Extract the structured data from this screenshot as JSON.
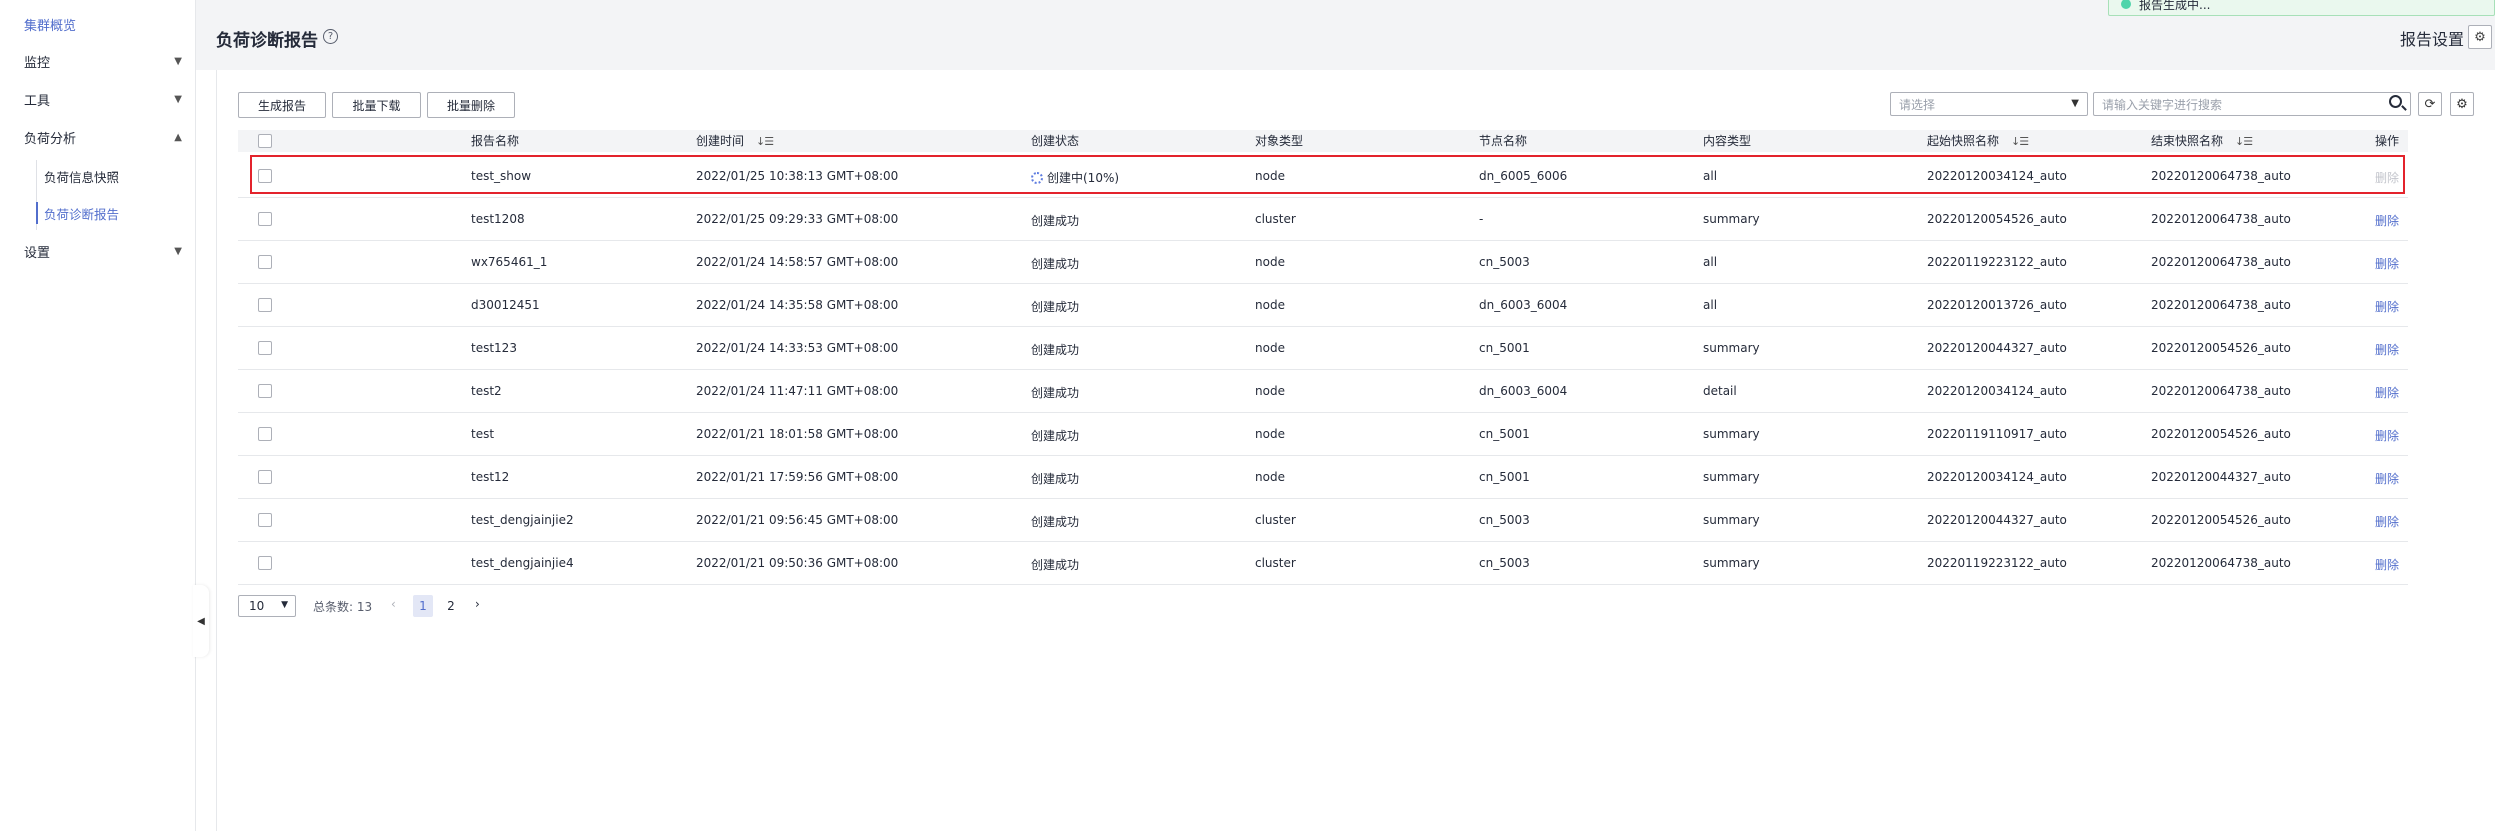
{
  "sidebar": {
    "items": [
      {
        "label": "集群概览",
        "active": true
      },
      {
        "label": "监控",
        "chevron": "chevron-down-icon"
      },
      {
        "label": "工具",
        "chevron": "chevron-down-icon"
      },
      {
        "label": "负荷分析",
        "chevron": "chevron-up-icon"
      },
      {
        "label": "设置",
        "chevron": "chevron-down-icon"
      }
    ],
    "sub_items": [
      {
        "label": "负荷信息快照"
      },
      {
        "label": "负荷诊断报告",
        "active": true
      }
    ],
    "collapse_glyph": "◀"
  },
  "header": {
    "title": "负荷诊断报告",
    "help_glyph": "?",
    "report_settings_label": "报告设置",
    "gear_glyph": "⚙",
    "toast_text": "报告生成中..."
  },
  "toolbar": {
    "generate_label": "生成报告",
    "batch_download_label": "批量下载",
    "batch_delete_label": "批量删除",
    "filter_placeholder": "请选择",
    "search_placeholder": "请输入关键字进行搜索",
    "refresh_glyph": "⟳",
    "settings_glyph": "⚙"
  },
  "table": {
    "columns": [
      "报告名称",
      "创建时间",
      "创建状态",
      "对象类型",
      "节点名称",
      "内容类型",
      "起始快照名称",
      "结束快照名称",
      "操作"
    ],
    "sort_glyph": "↓☰",
    "rows": [
      {
        "name": "test_show",
        "time": "2022/01/25 10:38:13 GMT+08:00",
        "status": "创建中(10%)",
        "creating": true,
        "obj": "node",
        "node": "dn_6005_6006",
        "content": "all",
        "start": "20220120034124_auto",
        "end": "20220120064738_auto",
        "op": "删除"
      },
      {
        "name": "test1208",
        "time": "2022/01/25 09:29:33 GMT+08:00",
        "status": "创建成功",
        "obj": "cluster",
        "node": "-",
        "content": "summary",
        "start": "20220120054526_auto",
        "end": "20220120064738_auto",
        "op": "删除"
      },
      {
        "name": "wx765461_1",
        "time": "2022/01/24 14:58:57 GMT+08:00",
        "status": "创建成功",
        "obj": "node",
        "node": "cn_5003",
        "content": "all",
        "start": "20220119223122_auto",
        "end": "20220120064738_auto",
        "op": "删除"
      },
      {
        "name": "d30012451",
        "time": "2022/01/24 14:35:58 GMT+08:00",
        "status": "创建成功",
        "obj": "node",
        "node": "dn_6003_6004",
        "content": "all",
        "start": "20220120013726_auto",
        "end": "20220120064738_auto",
        "op": "删除"
      },
      {
        "name": "test123",
        "time": "2022/01/24 14:33:53 GMT+08:00",
        "status": "创建成功",
        "obj": "node",
        "node": "cn_5001",
        "content": "summary",
        "start": "20220120044327_auto",
        "end": "20220120054526_auto",
        "op": "删除"
      },
      {
        "name": "test2",
        "time": "2022/01/24 11:47:11 GMT+08:00",
        "status": "创建成功",
        "obj": "node",
        "node": "dn_6003_6004",
        "content": "detail",
        "start": "20220120034124_auto",
        "end": "20220120064738_auto",
        "op": "删除"
      },
      {
        "name": "test",
        "time": "2022/01/21 18:01:58 GMT+08:00",
        "status": "创建成功",
        "obj": "node",
        "node": "cn_5001",
        "content": "summary",
        "start": "20220119110917_auto",
        "end": "20220120054526_auto",
        "op": "删除"
      },
      {
        "name": "test12",
        "time": "2022/01/21 17:59:56 GMT+08:00",
        "status": "创建成功",
        "obj": "node",
        "node": "cn_5001",
        "content": "summary",
        "start": "20220120034124_auto",
        "end": "20220120044327_auto",
        "op": "删除"
      },
      {
        "name": "test_dengjainjie2",
        "time": "2022/01/21 09:56:45 GMT+08:00",
        "status": "创建成功",
        "obj": "cluster",
        "node": "cn_5003",
        "content": "summary",
        "start": "20220120044327_auto",
        "end": "20220120054526_auto",
        "op": "删除"
      },
      {
        "name": "test_dengjainjie4",
        "time": "2022/01/21 09:50:36 GMT+08:00",
        "status": "创建成功",
        "obj": "cluster",
        "node": "cn_5003",
        "content": "summary",
        "start": "20220119223122_auto",
        "end": "20220120064738_auto",
        "op": "删除"
      }
    ]
  },
  "pagination": {
    "page_size": "10",
    "total_label": "总条数: 13",
    "prev_glyph": "‹",
    "next_glyph": "›",
    "pages": [
      "1",
      "2"
    ],
    "current_page": "1"
  },
  "colors": {
    "accent": "#526ecc",
    "highlight_border": "#e3232c",
    "header_bg": "#f3f4f6"
  }
}
